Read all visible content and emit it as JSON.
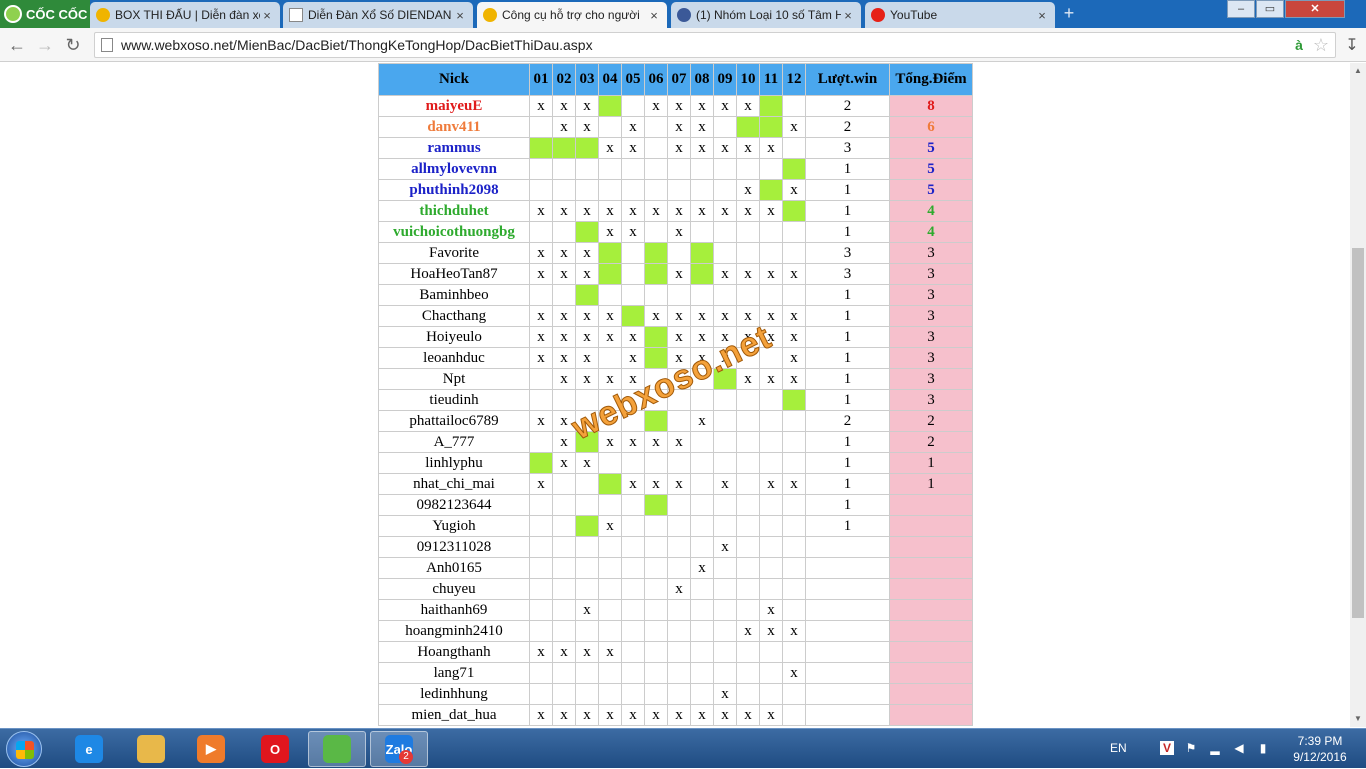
{
  "browser": {
    "logo_text": "CỐC CỐC",
    "tabs": [
      {
        "title": "BOX THI ĐẤU | Diễn đàn xổ",
        "icon": "webxoso-favicon",
        "color": "#f0b400",
        "active": false
      },
      {
        "title": "Diễn Đàn Xổ Số DIENDAN",
        "icon": "page-icon",
        "color": "#ffffff",
        "active": false
      },
      {
        "title": "Công cụ hỗ trợ cho người",
        "icon": "webxoso-favicon",
        "color": "#f0b400",
        "active": true
      },
      {
        "title": "(1) Nhóm Loại 10 số Tâm H",
        "icon": "facebook-icon",
        "color": "#3b5998",
        "active": false
      },
      {
        "title": "YouTube",
        "icon": "youtube-icon",
        "color": "#e62117",
        "active": false
      }
    ],
    "url": "www.webxoso.net/MienBac/DacBiet/ThongKeTongHop/DacBietThiDau.aspx",
    "url_badge": "à"
  },
  "table": {
    "headers": [
      "Nick",
      "01",
      "02",
      "03",
      "04",
      "05",
      "06",
      "07",
      "08",
      "09",
      "10",
      "11",
      "12",
      "Lượt.win",
      "Tổng.Điểm"
    ],
    "rows": [
      {
        "nick": "maiyeuE",
        "color": "#e01b1b",
        "bold": true,
        "cells": [
          "x",
          "x",
          "x",
          "G",
          "",
          "x",
          "x",
          "x",
          "x",
          "x",
          "G",
          ""
        ],
        "win": "2",
        "pts": "8"
      },
      {
        "nick": "danv411",
        "color": "#ef7b3b",
        "bold": true,
        "cells": [
          "",
          "x",
          "x",
          "",
          "x",
          "",
          "x",
          "x",
          "",
          "G",
          "G",
          "x"
        ],
        "win": "2",
        "pts": "6"
      },
      {
        "nick": "rammus",
        "color": "#1c22c8",
        "bold": true,
        "cells": [
          "G",
          "G",
          "G",
          "x",
          "x",
          "",
          "x",
          "x",
          "x",
          "x",
          "x",
          ""
        ],
        "win": "3",
        "pts": "5"
      },
      {
        "nick": "allmylovevnn",
        "color": "#1c22c8",
        "bold": true,
        "cells": [
          "",
          "",
          "",
          "",
          "",
          "",
          "",
          "",
          "",
          "",
          "",
          "G"
        ],
        "win": "1",
        "pts": "5"
      },
      {
        "nick": "phuthinh2098",
        "color": "#1c22c8",
        "bold": true,
        "cells": [
          "",
          "",
          "",
          "",
          "",
          "",
          "",
          "",
          "",
          "x",
          "G",
          "x"
        ],
        "win": "1",
        "pts": "5"
      },
      {
        "nick": "thichduhet",
        "color": "#2eaa2e",
        "bold": true,
        "cells": [
          "x",
          "x",
          "x",
          "x",
          "x",
          "x",
          "x",
          "x",
          "x",
          "x",
          "x",
          "G"
        ],
        "win": "1",
        "pts": "4"
      },
      {
        "nick": "vuichoicothuongbg",
        "color": "#2eaa2e",
        "bold": true,
        "cells": [
          "",
          "",
          "G",
          "x",
          "x",
          "",
          "x",
          "",
          "",
          "",
          "",
          ""
        ],
        "win": "1",
        "pts": "4"
      },
      {
        "nick": "Favorite",
        "color": "#000000",
        "bold": false,
        "cells": [
          "x",
          "x",
          "x",
          "G",
          "",
          "G",
          "",
          "G",
          "",
          "",
          "",
          ""
        ],
        "win": "3",
        "pts": "3"
      },
      {
        "nick": "HoaHeoTan87",
        "color": "#000000",
        "bold": false,
        "cells": [
          "x",
          "x",
          "x",
          "G",
          "",
          "G",
          "x",
          "G",
          "x",
          "x",
          "x",
          "x"
        ],
        "win": "3",
        "pts": "3"
      },
      {
        "nick": "Baminhbeo",
        "color": "#000000",
        "bold": false,
        "cells": [
          "",
          "",
          "G",
          "",
          "",
          "",
          "",
          "",
          "",
          "",
          "",
          ""
        ],
        "win": "1",
        "pts": "3"
      },
      {
        "nick": "Chacthang",
        "color": "#000000",
        "bold": false,
        "cells": [
          "x",
          "x",
          "x",
          "x",
          "G",
          "x",
          "x",
          "x",
          "x",
          "x",
          "x",
          "x"
        ],
        "win": "1",
        "pts": "3"
      },
      {
        "nick": "Hoiyeulo",
        "color": "#000000",
        "bold": false,
        "cells": [
          "x",
          "x",
          "x",
          "x",
          "x",
          "G",
          "x",
          "x",
          "x",
          "x",
          "x",
          "x"
        ],
        "win": "1",
        "pts": "3"
      },
      {
        "nick": "leoanhduc",
        "color": "#000000",
        "bold": false,
        "cells": [
          "x",
          "x",
          "x",
          "",
          "x",
          "G",
          "x",
          "x",
          "x",
          "",
          "",
          "x"
        ],
        "win": "1",
        "pts": "3"
      },
      {
        "nick": "Npt",
        "color": "#000000",
        "bold": false,
        "cells": [
          "",
          "x",
          "x",
          "x",
          "x",
          "",
          "",
          "",
          "G",
          "x",
          "x",
          "x"
        ],
        "win": "1",
        "pts": "3"
      },
      {
        "nick": "tieudinh",
        "color": "#000000",
        "bold": false,
        "cells": [
          "",
          "",
          "",
          "",
          "",
          "",
          "",
          "",
          "",
          "",
          "",
          "G"
        ],
        "win": "1",
        "pts": "3"
      },
      {
        "nick": "phattailoc6789",
        "color": "#000000",
        "bold": false,
        "cells": [
          "x",
          "x",
          "",
          "",
          "",
          "G",
          "",
          "x",
          "",
          "",
          "",
          ""
        ],
        "win": "2",
        "pts": "2"
      },
      {
        "nick": "A_777",
        "color": "#000000",
        "bold": false,
        "cells": [
          "",
          "x",
          "G",
          "x",
          "x",
          "x",
          "x",
          "",
          "",
          "",
          "",
          ""
        ],
        "win": "1",
        "pts": "2"
      },
      {
        "nick": "linhlyphu",
        "color": "#000000",
        "bold": false,
        "cells": [
          "G",
          "x",
          "x",
          "",
          "",
          "",
          "",
          "",
          "",
          "",
          "",
          ""
        ],
        "win": "1",
        "pts": "1"
      },
      {
        "nick": "nhat_chi_mai",
        "color": "#000000",
        "bold": false,
        "cells": [
          "x",
          "",
          "",
          "G",
          "x",
          "x",
          "x",
          "",
          "x",
          "",
          "x",
          "x"
        ],
        "win": "1",
        "pts": "1"
      },
      {
        "nick": "0982123644",
        "color": "#000000",
        "bold": false,
        "cells": [
          "",
          "",
          "",
          "",
          "",
          "G",
          "",
          "",
          "",
          "",
          "",
          ""
        ],
        "win": "1",
        "pts": ""
      },
      {
        "nick": "Yugioh",
        "color": "#000000",
        "bold": false,
        "cells": [
          "",
          "",
          "G",
          "x",
          "",
          "",
          "",
          "",
          "",
          "",
          "",
          ""
        ],
        "win": "1",
        "pts": ""
      },
      {
        "nick": "0912311028",
        "color": "#000000",
        "bold": false,
        "cells": [
          "",
          "",
          "",
          "",
          "",
          "",
          "",
          "",
          "x",
          "",
          "",
          ""
        ],
        "win": "",
        "pts": ""
      },
      {
        "nick": "Anh0165",
        "color": "#000000",
        "bold": false,
        "cells": [
          "",
          "",
          "",
          "",
          "",
          "",
          "",
          "x",
          "",
          "",
          "",
          ""
        ],
        "win": "",
        "pts": ""
      },
      {
        "nick": "chuyeu",
        "color": "#000000",
        "bold": false,
        "cells": [
          "",
          "",
          "",
          "",
          "",
          "",
          "x",
          "",
          "",
          "",
          "",
          ""
        ],
        "win": "",
        "pts": ""
      },
      {
        "nick": "haithanh69",
        "color": "#000000",
        "bold": false,
        "cells": [
          "",
          "",
          "x",
          "",
          "",
          "",
          "",
          "",
          "",
          "",
          "x",
          ""
        ],
        "win": "",
        "pts": ""
      },
      {
        "nick": "hoangminh2410",
        "color": "#000000",
        "bold": false,
        "cells": [
          "",
          "",
          "",
          "",
          "",
          "",
          "",
          "",
          "",
          "x",
          "x",
          "x"
        ],
        "win": "",
        "pts": ""
      },
      {
        "nick": "Hoangthanh",
        "color": "#000000",
        "bold": false,
        "cells": [
          "x",
          "x",
          "x",
          "x",
          "",
          "",
          "",
          "",
          "",
          "",
          "",
          ""
        ],
        "win": "",
        "pts": ""
      },
      {
        "nick": "lang71",
        "color": "#000000",
        "bold": false,
        "cells": [
          "",
          "",
          "",
          "",
          "",
          "",
          "",
          "",
          "",
          "",
          "",
          "x"
        ],
        "win": "",
        "pts": ""
      },
      {
        "nick": "ledinhhung",
        "color": "#000000",
        "bold": false,
        "cells": [
          "",
          "",
          "",
          "",
          "",
          "",
          "",
          "",
          "x",
          "",
          "",
          ""
        ],
        "win": "",
        "pts": ""
      },
      {
        "nick": "mien_dat_hua",
        "color": "#000000",
        "bold": false,
        "cells": [
          "x",
          "x",
          "x",
          "x",
          "x",
          "x",
          "x",
          "x",
          "x",
          "x",
          "x",
          ""
        ],
        "win": "",
        "pts": ""
      }
    ],
    "green_color": "#a6ef3c",
    "points_color": "#f6c0cc",
    "header_color": "#4aa7ee"
  },
  "watermark": "webxoso.net",
  "taskbar": {
    "apps": [
      {
        "name": "internet-explorer-icon",
        "label": "e",
        "color": "#1e88e5"
      },
      {
        "name": "file-explorer-icon",
        "label": "",
        "color": "#e8b84a"
      },
      {
        "name": "media-player-icon",
        "label": "▶",
        "color": "#ef7b2b"
      },
      {
        "name": "opera-icon",
        "label": "O",
        "color": "#e0161e"
      },
      {
        "name": "coccoc-browser-icon",
        "label": "",
        "color": "#5ab846"
      },
      {
        "name": "zalo-icon",
        "label": "Zalo",
        "color": "#1f7be0"
      }
    ],
    "zalo_badge": "2",
    "lang": "EN",
    "time": "7:39 PM",
    "date": "9/12/2016"
  }
}
